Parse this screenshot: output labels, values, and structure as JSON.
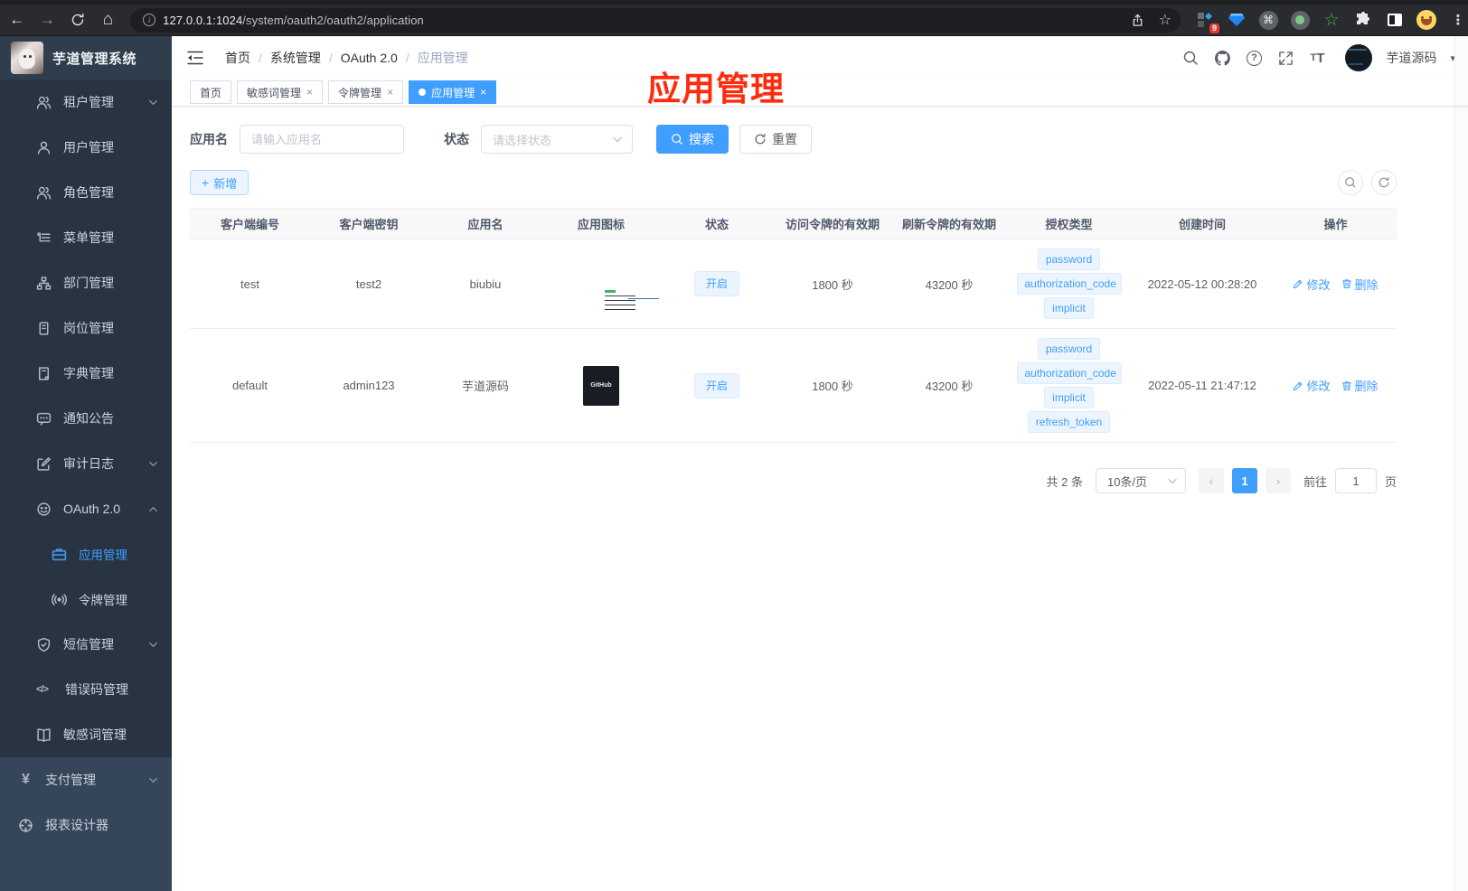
{
  "browser": {
    "url_host": "127.0.0.1:1024",
    "url_path": "/system/oauth2/oauth2/application",
    "extensions_badge": "9"
  },
  "icons": {
    "back": "←",
    "forward": "→",
    "home": "⌂",
    "info": "i",
    "star": "☆",
    "dots": "⋮",
    "command": "⌘",
    "green_star": "☆",
    "close": "×",
    "plus": "+",
    "caret": "▾",
    "help": "?",
    "font_large": "T",
    "font_small": "T",
    "yen": "¥",
    "code": "</>",
    "prev": "‹",
    "next": "›",
    "slash": "/"
  },
  "sidebar": {
    "app_title": "芋道管理系统",
    "menu": [
      {
        "label": "租户管理"
      },
      {
        "label": "用户管理"
      },
      {
        "label": "角色管理"
      },
      {
        "label": "菜单管理"
      },
      {
        "label": "部门管理"
      },
      {
        "label": "岗位管理"
      },
      {
        "label": "字典管理"
      },
      {
        "label": "通知公告"
      },
      {
        "label": "审计日志"
      },
      {
        "label": "OAuth 2.0"
      },
      {
        "label": "应用管理"
      },
      {
        "label": "令牌管理"
      },
      {
        "label": "短信管理"
      },
      {
        "label": "错误码管理"
      },
      {
        "label": "敏感词管理"
      },
      {
        "label": "支付管理"
      },
      {
        "label": "报表设计器"
      }
    ]
  },
  "header": {
    "breadcrumb": [
      "首页",
      "系统管理",
      "OAuth 2.0",
      "应用管理"
    ],
    "username": "芋道源码"
  },
  "tabs": [
    {
      "label": "首页"
    },
    {
      "label": "敏感词管理"
    },
    {
      "label": "令牌管理"
    },
    {
      "label": "应用管理"
    }
  ],
  "annotation": "应用管理",
  "filter": {
    "name_label": "应用名",
    "name_placeholder": "请输入应用名",
    "status_label": "状态",
    "status_placeholder": "请选择状态",
    "search_label": "搜索",
    "reset_label": "重置",
    "add_label": "新增"
  },
  "table": {
    "headers": [
      "客户端编号",
      "客户端密钥",
      "应用名",
      "应用图标",
      "状态",
      "访问令牌的有效期",
      "刷新令牌的有效期",
      "授权类型",
      "创建时间",
      "操作"
    ],
    "rows": [
      {
        "client_id": "test",
        "secret": "test2",
        "name": "biubiu",
        "status": "开启",
        "access_ttl": "1800 秒",
        "refresh_ttl": "43200 秒",
        "grants": [
          "password",
          "authorization_code",
          "implicit"
        ],
        "created": "2022-05-12 00:28:20"
      },
      {
        "client_id": "default",
        "secret": "admin123",
        "name": "芋道源码",
        "icon_text": "GitHub",
        "status": "开启",
        "access_ttl": "1800 秒",
        "refresh_ttl": "43200 秒",
        "grants": [
          "password",
          "authorization_code",
          "implicit",
          "refresh_token"
        ],
        "created": "2022-05-11 21:47:12"
      }
    ],
    "edit_label": "修改",
    "delete_label": "删除"
  },
  "pagination": {
    "total": "共 2 条",
    "page_size": "10条/页",
    "page": "1",
    "goto_label": "前往",
    "goto_value": "1",
    "unit_label": "页"
  },
  "colors": {
    "accent": "#409eff",
    "annotation_red": "#ff2b0e"
  }
}
